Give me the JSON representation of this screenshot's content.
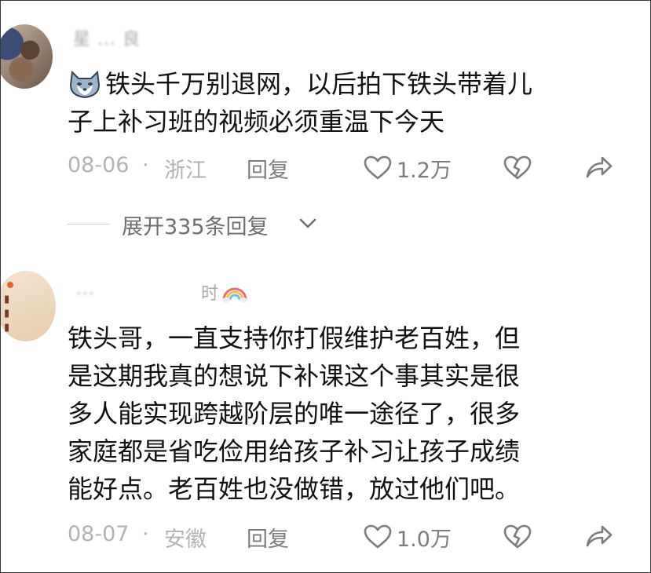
{
  "comments": [
    {
      "username": "星 ... 良",
      "emoji": "wolf-emoji",
      "text_line1": "铁头千万别退网，以后拍下铁头带着儿",
      "text_line2": "子上补习班的视频必须重温下今天",
      "date": "08-06",
      "location": "浙江",
      "reply_label": "回复",
      "likes": "1.2万"
    },
    {
      "username": "...",
      "username_tail": "时",
      "text_lines": [
        "铁头哥，一直支持你打假维护老百姓，但",
        "是这期我真的想说下补课这个事其实是很",
        "多人能实现跨越阶层的唯一途径了，很多",
        "家庭都是省吃俭用给孩子补习让孩子成绩",
        "能好点。老百姓也没做错，放过他们吧。"
      ],
      "date": "08-07",
      "location": "安徽",
      "reply_label": "回复",
      "likes": "1.0万"
    }
  ],
  "expand": {
    "label": "展开335条回复"
  },
  "meta_separator": "·",
  "colors": {
    "text": "#111111",
    "meta": "#b3b3b3",
    "action": "#7d7d7d"
  }
}
